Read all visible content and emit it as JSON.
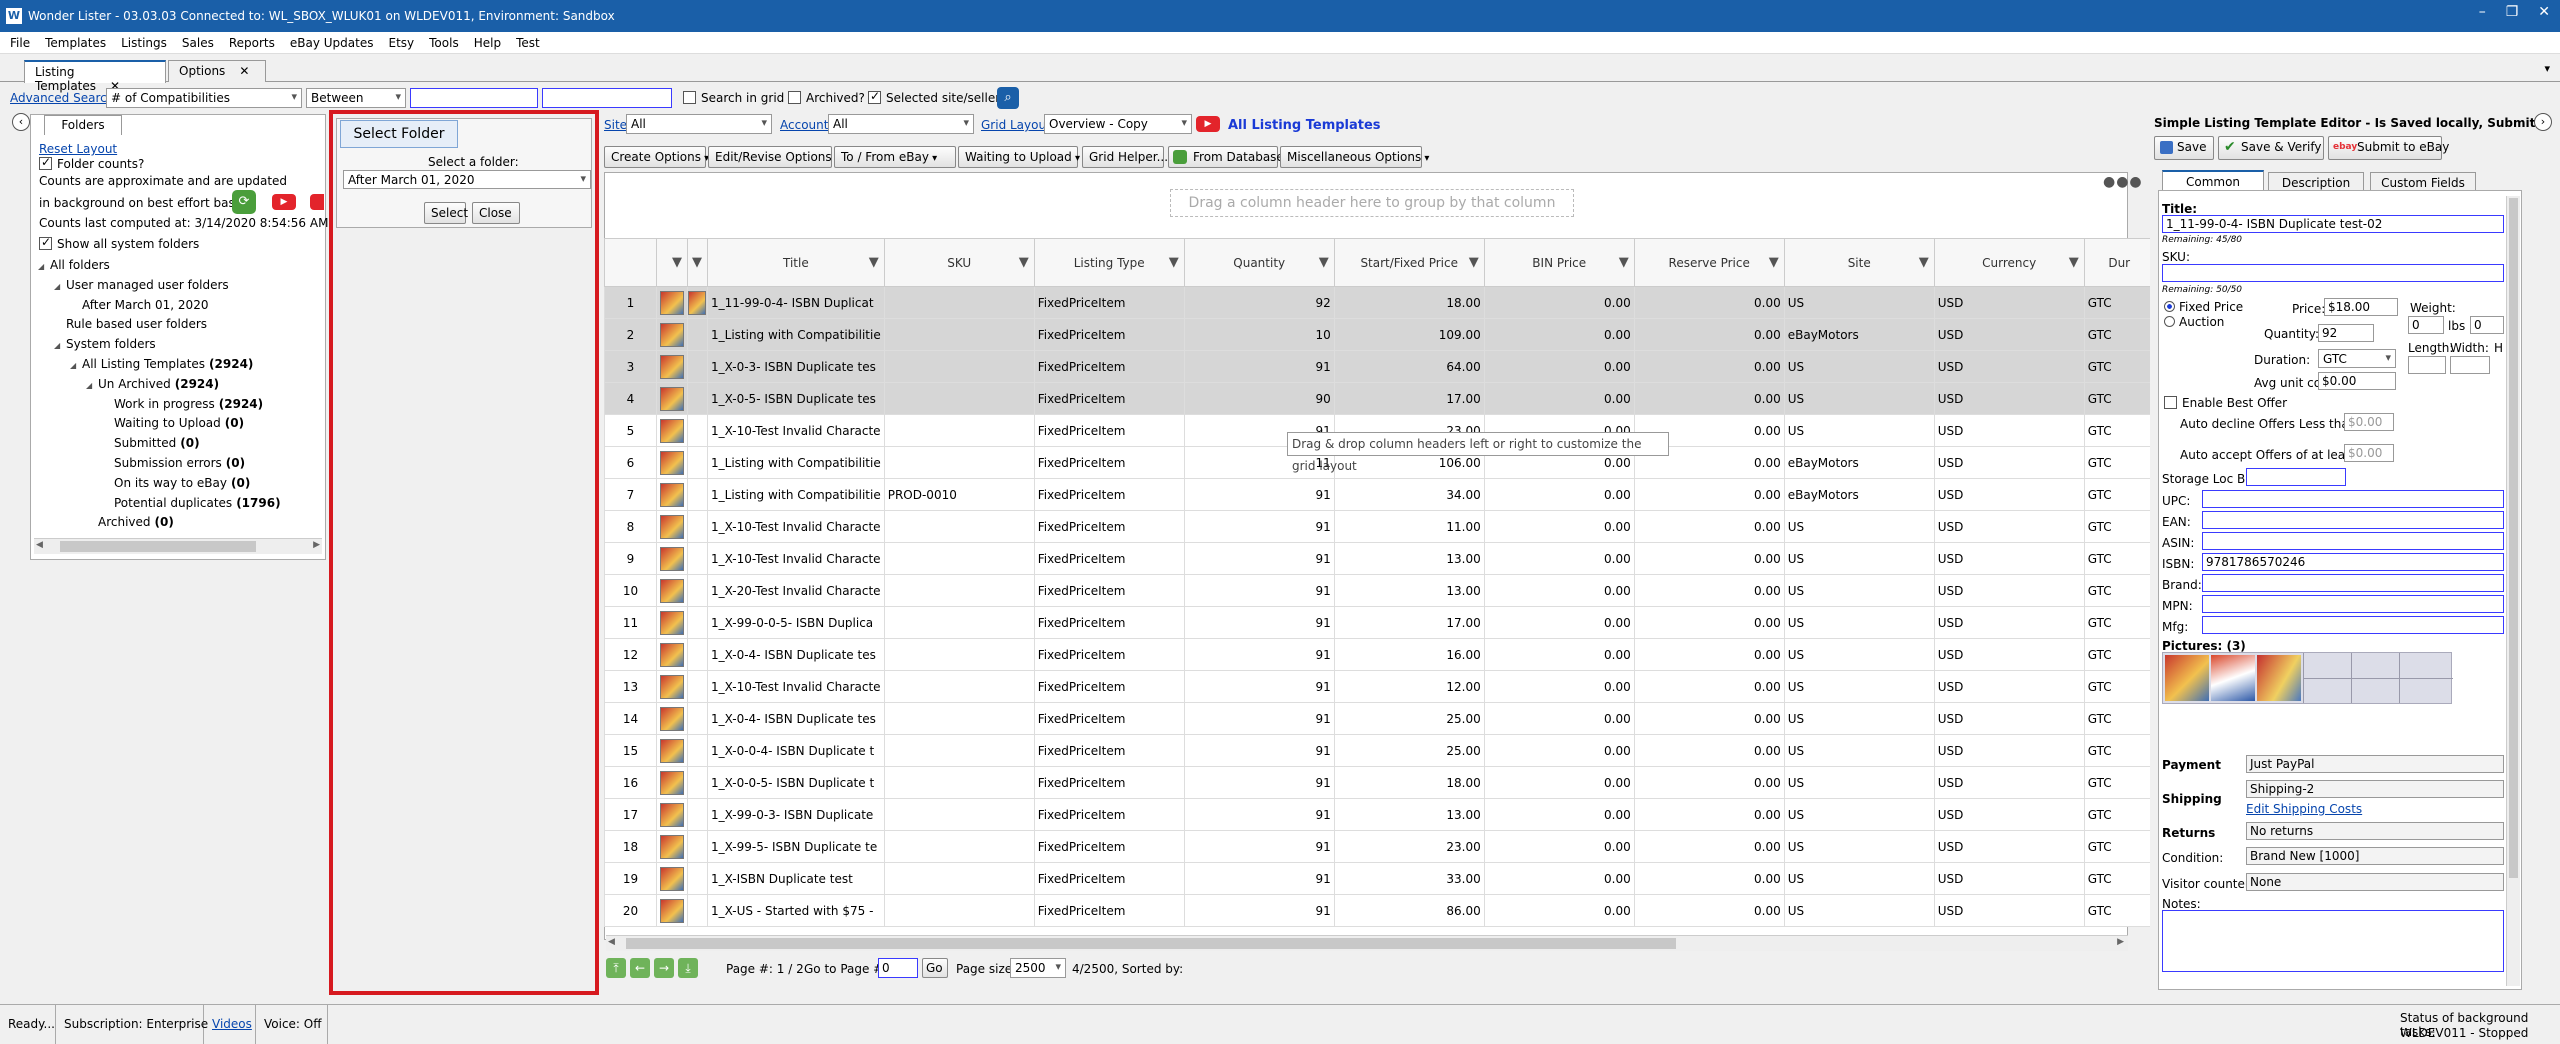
{
  "window": {
    "title": "Wonder Lister - 03.03.03 Connected to: WL_SBOX_WLUK01 on WLDEV011, Environment: Sandbox"
  },
  "menu": [
    "File",
    "Templates",
    "Listings",
    "Sales",
    "Reports",
    "eBay Updates",
    "Etsy",
    "Tools",
    "Help",
    "Test"
  ],
  "doc_tabs": [
    {
      "label": "Listing Templates",
      "close": "✕"
    },
    {
      "label": "Options",
      "close": "✕"
    }
  ],
  "toolbar": {
    "advanced_search": "Advanced Search",
    "field": "# of Compatibilities",
    "operator": "Between",
    "search_in_grid": "Search in grid",
    "archived": "Archived?",
    "selected_site": "Selected site/seller"
  },
  "left": {
    "tab": "Folders",
    "reset_layout": "Reset Layout",
    "folder_counts": "Folder counts?",
    "approx1": "Counts are approximate and are updated",
    "approx2": "in background on best effort basis",
    "last_computed": "Counts last computed at: 3/14/2020 8:54:56 AM",
    "show_all": "Show all system folders",
    "tree": [
      {
        "label": "All folders",
        "count": "",
        "indent": 0,
        "exp": "◢"
      },
      {
        "label": "User managed user folders",
        "count": "",
        "indent": 1,
        "exp": "◢"
      },
      {
        "label": "After March 01, 2020",
        "count": "",
        "indent": 2,
        "exp": ""
      },
      {
        "label": "Rule based user folders",
        "count": "",
        "indent": 1,
        "exp": ""
      },
      {
        "label": "System folders",
        "count": "",
        "indent": 1,
        "exp": "◢"
      },
      {
        "label": "All Listing Templates",
        "count": "(2924)",
        "indent": 2,
        "exp": "◢"
      },
      {
        "label": "Un Archived",
        "count": "(2924)",
        "indent": 3,
        "exp": "◢"
      },
      {
        "label": "Work in progress",
        "count": "(2924)",
        "indent": 4,
        "exp": ""
      },
      {
        "label": "Waiting to Upload",
        "count": "(0)",
        "indent": 4,
        "exp": ""
      },
      {
        "label": "Submitted",
        "count": "(0)",
        "indent": 4,
        "exp": ""
      },
      {
        "label": "Submission errors",
        "count": "(0)",
        "indent": 4,
        "exp": ""
      },
      {
        "label": "On its way to eBay",
        "count": "(0)",
        "indent": 4,
        "exp": ""
      },
      {
        "label": "Potential duplicates",
        "count": "(1796)",
        "indent": 4,
        "exp": ""
      },
      {
        "label": "Archived",
        "count": "(0)",
        "indent": 3,
        "exp": ""
      }
    ]
  },
  "select_folder": {
    "title": "Select Folder",
    "prompt": "Select a folder:",
    "value": "After March 01, 2020",
    "select_btn": "Select",
    "close_btn": "Close"
  },
  "grid_top": {
    "site_label": "Site",
    "site_value": "All",
    "account_label": "Account",
    "account_value": "All",
    "grid_layout_label": "Grid Layout",
    "grid_layout_value": "Overview - Copy",
    "heading": "All Listing Templates",
    "buttons": [
      "Create Options",
      "Edit/Revise Options",
      "To / From eBay",
      "Waiting to Upload",
      "Grid Helper...",
      "From Database",
      "Miscellaneous Options"
    ],
    "group_hint": "Drag a column header here to group by that column"
  },
  "grid": {
    "columns": [
      "",
      "",
      "",
      "Title",
      "SKU",
      "Listing Type",
      "Quantity",
      "Start/Fixed Price",
      "BIN Price",
      "Reserve Price",
      "Site",
      "Currency",
      "Dur"
    ],
    "rows": [
      [
        "1",
        "1_11-99-0-4- ISBN Duplicat",
        "",
        "FixedPriceItem",
        "92",
        "18.00",
        "0.00",
        "0.00",
        "US",
        "USD",
        "GTC"
      ],
      [
        "2",
        "1_Listing with Compatibilitie",
        "",
        "FixedPriceItem",
        "10",
        "109.00",
        "0.00",
        "0.00",
        "eBayMotors",
        "USD",
        "GTC"
      ],
      [
        "3",
        "1_X-0-3- ISBN Duplicate tes",
        "",
        "FixedPriceItem",
        "91",
        "64.00",
        "0.00",
        "0.00",
        "US",
        "USD",
        "GTC"
      ],
      [
        "4",
        "1_X-0-5- ISBN Duplicate tes",
        "",
        "FixedPriceItem",
        "90",
        "17.00",
        "0.00",
        "0.00",
        "US",
        "USD",
        "GTC"
      ],
      [
        "5",
        "1_X-10-Test Invalid Characte",
        "",
        "FixedPriceItem",
        "91",
        "23.00",
        "0.00",
        "0.00",
        "US",
        "USD",
        "GTC"
      ],
      [
        "6",
        "1_Listing with Compatibilitie",
        "",
        "FixedPriceItem",
        "11",
        "106.00",
        "0.00",
        "0.00",
        "eBayMotors",
        "USD",
        "GTC"
      ],
      [
        "7",
        "1_Listing with Compatibilitie",
        "PROD-0010",
        "FixedPriceItem",
        "91",
        "34.00",
        "0.00",
        "0.00",
        "eBayMotors",
        "USD",
        "GTC"
      ],
      [
        "8",
        "1_X-10-Test Invalid Characte",
        "",
        "FixedPriceItem",
        "91",
        "11.00",
        "0.00",
        "0.00",
        "US",
        "USD",
        "GTC"
      ],
      [
        "9",
        "1_X-10-Test Invalid Characte",
        "",
        "FixedPriceItem",
        "91",
        "13.00",
        "0.00",
        "0.00",
        "US",
        "USD",
        "GTC"
      ],
      [
        "10",
        "1_X-20-Test Invalid Characte",
        "",
        "FixedPriceItem",
        "91",
        "13.00",
        "0.00",
        "0.00",
        "US",
        "USD",
        "GTC"
      ],
      [
        "11",
        "1_X-99-0-0-5- ISBN Duplica",
        "",
        "FixedPriceItem",
        "91",
        "17.00",
        "0.00",
        "0.00",
        "US",
        "USD",
        "GTC"
      ],
      [
        "12",
        "1_X-0-4- ISBN Duplicate tes",
        "",
        "FixedPriceItem",
        "91",
        "16.00",
        "0.00",
        "0.00",
        "US",
        "USD",
        "GTC"
      ],
      [
        "13",
        "1_X-10-Test Invalid Characte",
        "",
        "FixedPriceItem",
        "91",
        "12.00",
        "0.00",
        "0.00",
        "US",
        "USD",
        "GTC"
      ],
      [
        "14",
        "1_X-0-4- ISBN Duplicate tes",
        "",
        "FixedPriceItem",
        "91",
        "25.00",
        "0.00",
        "0.00",
        "US",
        "USD",
        "GTC"
      ],
      [
        "15",
        "1_X-0-0-4- ISBN Duplicate t",
        "",
        "FixedPriceItem",
        "91",
        "25.00",
        "0.00",
        "0.00",
        "US",
        "USD",
        "GTC"
      ],
      [
        "16",
        "1_X-0-0-5- ISBN Duplicate t",
        "",
        "FixedPriceItem",
        "91",
        "18.00",
        "0.00",
        "0.00",
        "US",
        "USD",
        "GTC"
      ],
      [
        "17",
        "1_X-99-0-3- ISBN Duplicate",
        "",
        "FixedPriceItem",
        "91",
        "13.00",
        "0.00",
        "0.00",
        "US",
        "USD",
        "GTC"
      ],
      [
        "18",
        "1_X-99-5- ISBN Duplicate te",
        "",
        "FixedPriceItem",
        "91",
        "23.00",
        "0.00",
        "0.00",
        "US",
        "USD",
        "GTC"
      ],
      [
        "19",
        "1_X-ISBN Duplicate test",
        "",
        "FixedPriceItem",
        "91",
        "33.00",
        "0.00",
        "0.00",
        "US",
        "USD",
        "GTC"
      ],
      [
        "20",
        "1_X-US - Started with $75 -",
        "",
        "FixedPriceItem",
        "91",
        "86.00",
        "0.00",
        "0.00",
        "US",
        "USD",
        "GTC"
      ]
    ],
    "tooltip": "Drag & drop column headers left or right to customize the grid layout"
  },
  "pager": {
    "page": "Page #: 1 / 2",
    "goto_label": "Go to Page #:",
    "goto_value": "0",
    "go": "Go",
    "page_size_label": "Page size:",
    "page_size": "2500",
    "summary": "4/2500, Sorted by:"
  },
  "editor": {
    "title": "Simple Listing Template Editor - Is Saved locally, Submit will create",
    "save": "Save",
    "save_verify": "Save & Verify",
    "submit": "Submit to eBay",
    "tabs": [
      "Common Fields",
      "Description",
      "Custom Fields"
    ],
    "title_label": "Title:",
    "title_value": "1_11-99-0-4- ISBN Duplicate test-02",
    "remaining_title": "Remaining: 45/80",
    "sku_label": "SKU:",
    "remaining_sku": "Remaining: 50/50",
    "fixed_price": "Fixed Price",
    "auction": "Auction",
    "price_label": "Price:",
    "price_value": "$18.00",
    "weight_label": "Weight:",
    "weight_value": "0",
    "lbs": "lbs",
    "weight2": "0",
    "quantity_label": "Quantity:",
    "quantity_value": "92",
    "length": "Length:",
    "width": "Width:",
    "height_short": "H",
    "duration_label": "Duration:",
    "duration_value": "GTC",
    "avg_cost_label": "Avg unit cost:",
    "avg_cost_value": "$0.00",
    "best_offer": "Enable Best Offer",
    "auto_decline": "Auto decline Offers Less than:",
    "auto_decline_value": "$0.00",
    "auto_accept": "Auto accept Offers of at least:",
    "auto_accept_value": "$0.00",
    "storage": "Storage Loc Bin:",
    "upc": "UPC:",
    "ean": "EAN:",
    "asin": "ASIN:",
    "isbn": "ISBN:",
    "isbn_value": "9781786570246",
    "brand": "Brand:",
    "mpn": "MPN:",
    "mfg": "Mfg:",
    "pictures": "Pictures: (3)",
    "payment": "Payment",
    "payment_value": "Just PayPal",
    "shipping": "Shipping",
    "shipping_value": "Shipping-2",
    "edit_shipping": "Edit Shipping Costs",
    "returns": "Returns",
    "returns_value": "No returns",
    "condition_label": "Condition:",
    "condition_value": "Brand New [1000]",
    "visitor_label": "Visitor counter:",
    "visitor_value": "None",
    "notes": "Notes:"
  },
  "status": {
    "ready": "Ready...",
    "subscription": "Subscription: Enterprise",
    "videos": "Videos",
    "voice": "Voice:  Off",
    "bg1": "Status of background tasks:",
    "bg2": "WLDEV011 - Stopped"
  }
}
